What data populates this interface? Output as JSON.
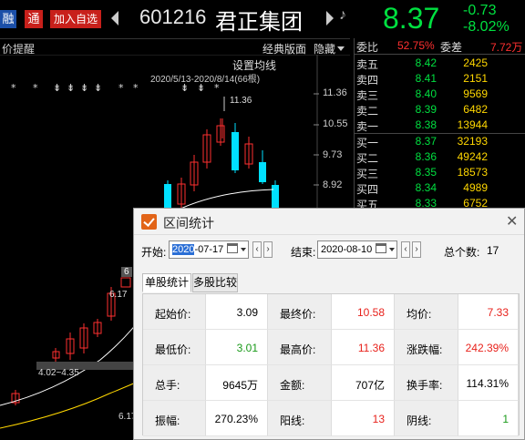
{
  "header": {
    "tag_rong": "融",
    "tag_tong": "通",
    "add_fav": "加入自选",
    "code": "601216",
    "name": "君正集团",
    "price": "8.37",
    "change": "-0.73",
    "change_pct": "-8.02%"
  },
  "chart_toolbar": {
    "reminder": "价提醒",
    "classic": "经典版面",
    "hide": "隐藏"
  },
  "chart": {
    "setma": "设置均线",
    "range_label": "2020/5/13-2020/8/14(66根)",
    "high_label": "11.36",
    "y_ticks": [
      "11.36",
      "10.55",
      "9.73",
      "8.92"
    ],
    "annot1": "4.02~4.35",
    "annot2": "6",
    "annot3": "6.17",
    "annot4": "6.17-"
  },
  "book": {
    "wb_label": "委比",
    "wb_value": "52.75%",
    "wc_label": "委差",
    "wc_value": "7.72万",
    "asks": [
      {
        "label": "卖五",
        "price": "8.42",
        "vol": "2425"
      },
      {
        "label": "卖四",
        "price": "8.41",
        "vol": "2151"
      },
      {
        "label": "卖三",
        "price": "8.40",
        "vol": "9569"
      },
      {
        "label": "卖二",
        "price": "8.39",
        "vol": "6482"
      },
      {
        "label": "卖一",
        "price": "8.38",
        "vol": "13944"
      }
    ],
    "bids": [
      {
        "label": "买一",
        "price": "8.37",
        "vol": "32193"
      },
      {
        "label": "买二",
        "price": "8.36",
        "vol": "49242"
      },
      {
        "label": "买三",
        "price": "8.35",
        "vol": "18573"
      },
      {
        "label": "买四",
        "price": "8.34",
        "vol": "4989"
      },
      {
        "label": "买五",
        "price": "8.33",
        "vol": "6752"
      }
    ]
  },
  "dialog": {
    "title": "区间统计",
    "start_label": "开始:",
    "start_year": "2020",
    "start_rest": "-07-17",
    "end_label": "结束:",
    "end_value": "2020-08-10",
    "count_label": "总个数:",
    "count_value": "17",
    "tab1": "单股统计",
    "tab2": "多股比较",
    "stats": [
      [
        {
          "label": "起始价:",
          "value": "3.09",
          "color": "black"
        },
        {
          "label": "最终价:",
          "value": "10.58",
          "color": "red"
        },
        {
          "label": "均价:",
          "value": "7.33",
          "color": "red"
        }
      ],
      [
        {
          "label": "最低价:",
          "value": "3.01",
          "color": "green"
        },
        {
          "label": "最高价:",
          "value": "11.36",
          "color": "red"
        },
        {
          "label": "涨跌幅:",
          "value": "242.39%",
          "color": "red"
        }
      ],
      [
        {
          "label": "总手:",
          "value": "9645万",
          "color": "black"
        },
        {
          "label": "金额:",
          "value": "707亿",
          "color": "black"
        },
        {
          "label": "换手率:",
          "value": "114.31%",
          "color": "black"
        }
      ],
      [
        {
          "label": "振幅:",
          "value": "270.23%",
          "color": "black"
        },
        {
          "label": "阳线:",
          "value": "13",
          "color": "red"
        },
        {
          "label": "阴线:",
          "value": "1",
          "color": "green"
        }
      ]
    ]
  }
}
